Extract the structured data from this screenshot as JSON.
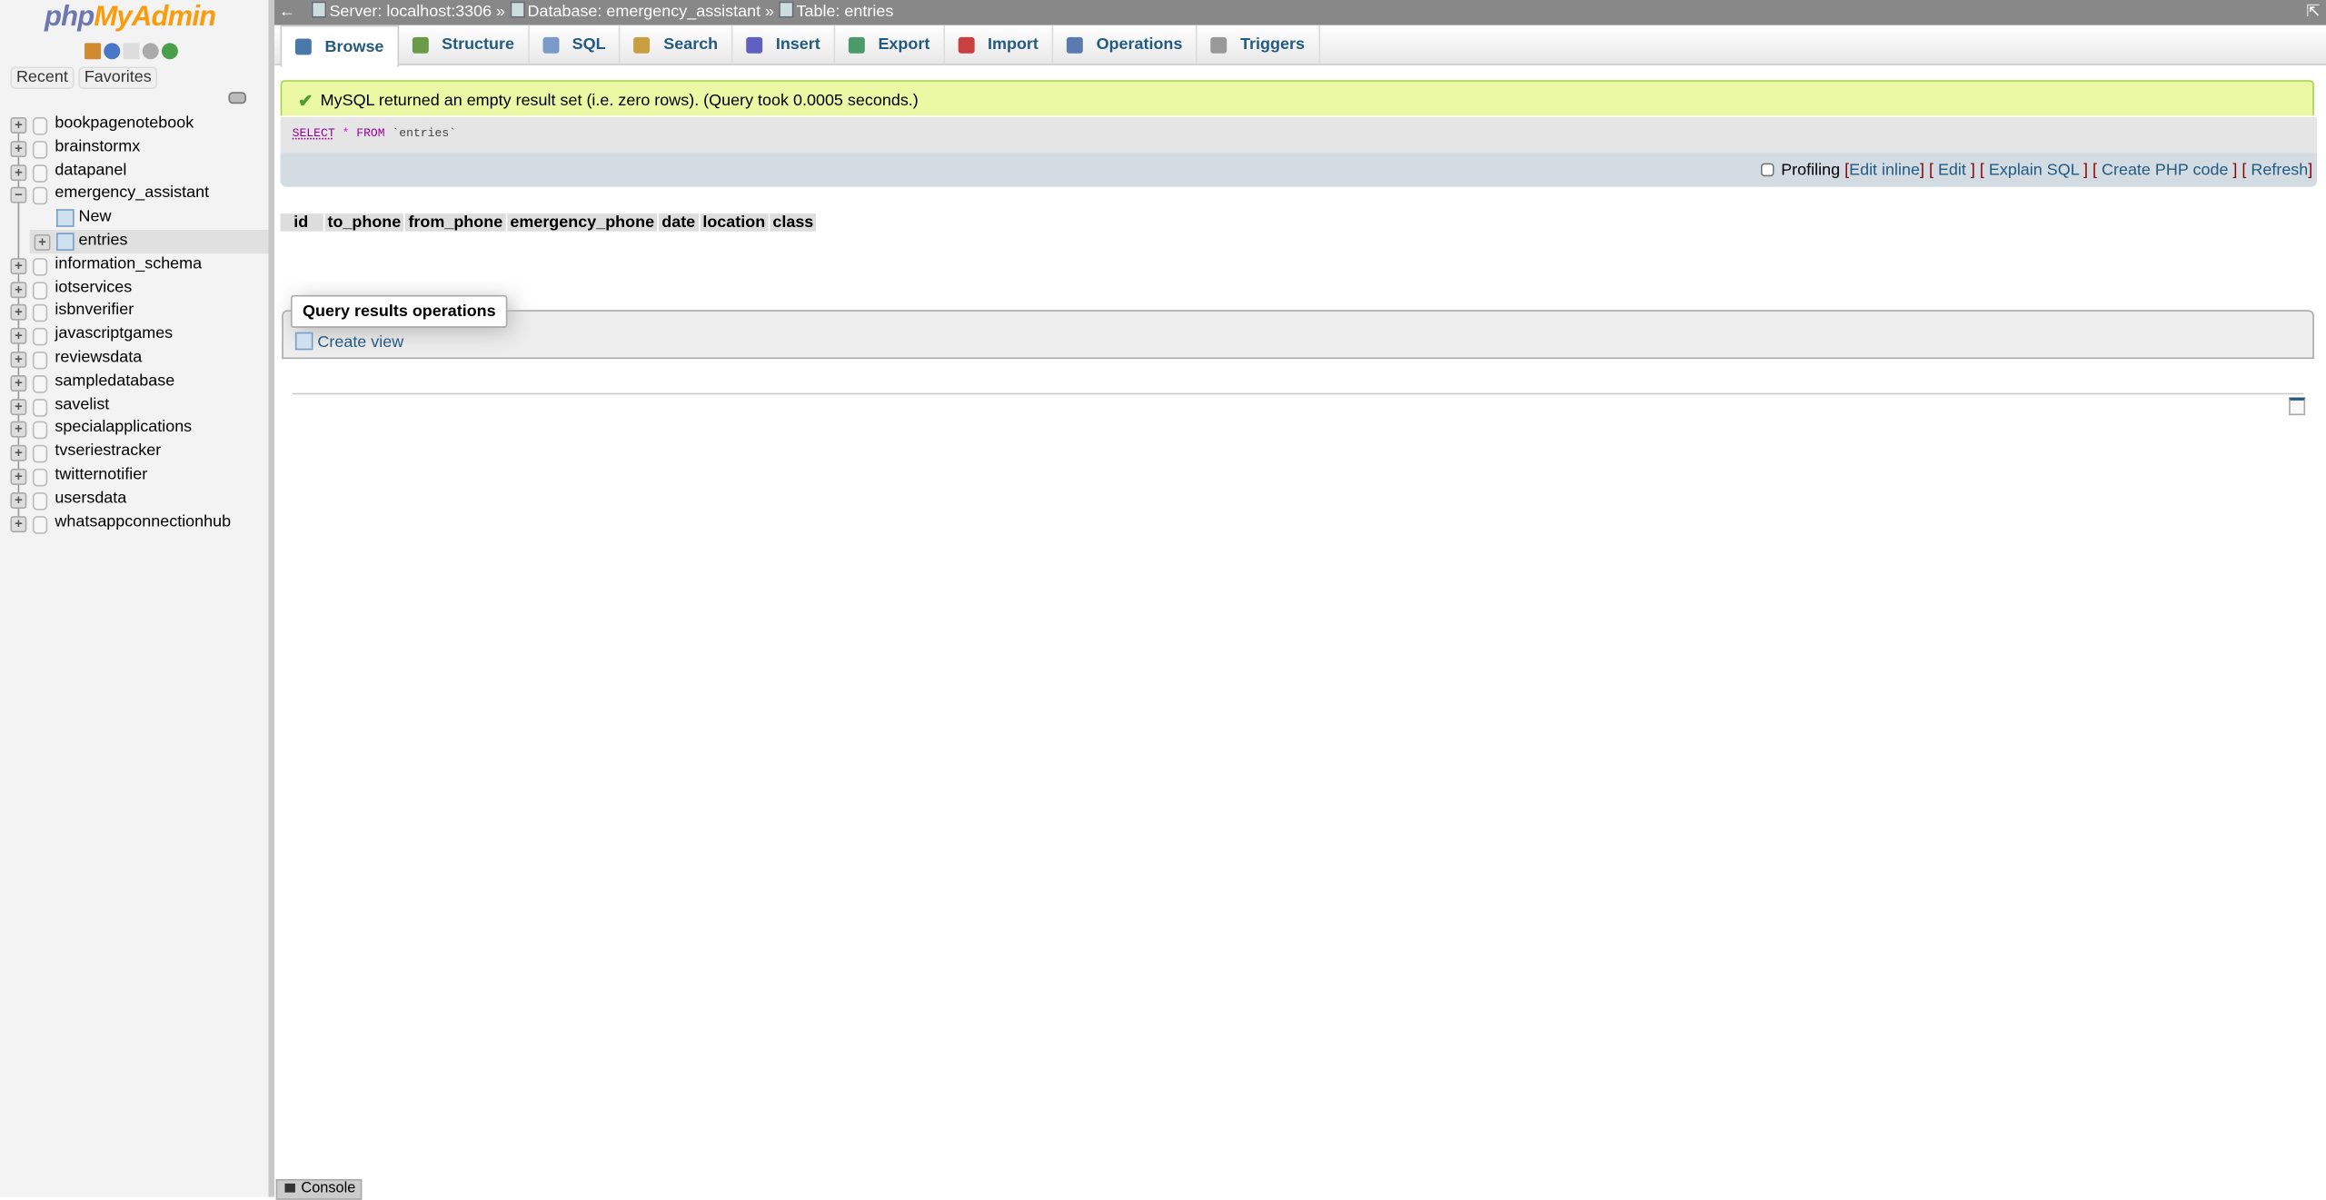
{
  "sidebar": {
    "logo": {
      "php": "php",
      "myadmin": "MyAdmin"
    },
    "recent": "Recent",
    "favorites": "Favorites",
    "databases": [
      {
        "name": "bookpagenotebook",
        "expanded": false
      },
      {
        "name": "brainstormx",
        "expanded": false
      },
      {
        "name": "datapanel",
        "expanded": false
      },
      {
        "name": "emergency_assistant",
        "expanded": true,
        "children": [
          "New",
          "entries"
        ]
      },
      {
        "name": "information_schema",
        "expanded": false
      },
      {
        "name": "iotservices",
        "expanded": false
      },
      {
        "name": "isbnverifier",
        "expanded": false
      },
      {
        "name": "javascriptgames",
        "expanded": false
      },
      {
        "name": "reviewsdata",
        "expanded": false
      },
      {
        "name": "sampledatabase",
        "expanded": false
      },
      {
        "name": "savelist",
        "expanded": false
      },
      {
        "name": "specialapplications",
        "expanded": false
      },
      {
        "name": "tvseriestracker",
        "expanded": false
      },
      {
        "name": "twitternotifier",
        "expanded": false
      },
      {
        "name": "usersdata",
        "expanded": false
      },
      {
        "name": "whatsappconnectionhub",
        "expanded": false
      }
    ]
  },
  "topbar": {
    "back": "←",
    "server": "Server: localhost:3306",
    "sep": "»",
    "database": "Database: emergency_assistant",
    "table": "Table: entries",
    "collapse": "⇱"
  },
  "tabs": [
    {
      "label": "Browse",
      "color": "#4a78a8"
    },
    {
      "label": "Structure",
      "color": "#6a9a4a"
    },
    {
      "label": "SQL",
      "color": "#7a9ac8"
    },
    {
      "label": "Search",
      "color": "#c8a040"
    },
    {
      "label": "Insert",
      "color": "#6060c0"
    },
    {
      "label": "Export",
      "color": "#4a9a6a"
    },
    {
      "label": "Import",
      "color": "#c84040"
    },
    {
      "label": "Operations",
      "color": "#5a7ab0"
    },
    {
      "label": "Triggers",
      "color": "#999999"
    }
  ],
  "message": "MySQL returned an empty result set (i.e. zero rows). (Query took 0.0005 seconds.)",
  "sql": {
    "select": "SELECT",
    "star": "*",
    "from": "FROM",
    "table": "`entries`"
  },
  "toolbar": {
    "profiling": "Profiling",
    "edit_inline": "Edit inline",
    "edit": "Edit",
    "explain": "Explain SQL",
    "php": "Create PHP code",
    "refresh": "Refresh"
  },
  "columns": [
    "id",
    "to_phone",
    "from_phone",
    "emergency_phone",
    "date",
    "location",
    "class"
  ],
  "operations": {
    "legend": "Query results operations",
    "create_view": "Create view"
  },
  "console": "Console"
}
